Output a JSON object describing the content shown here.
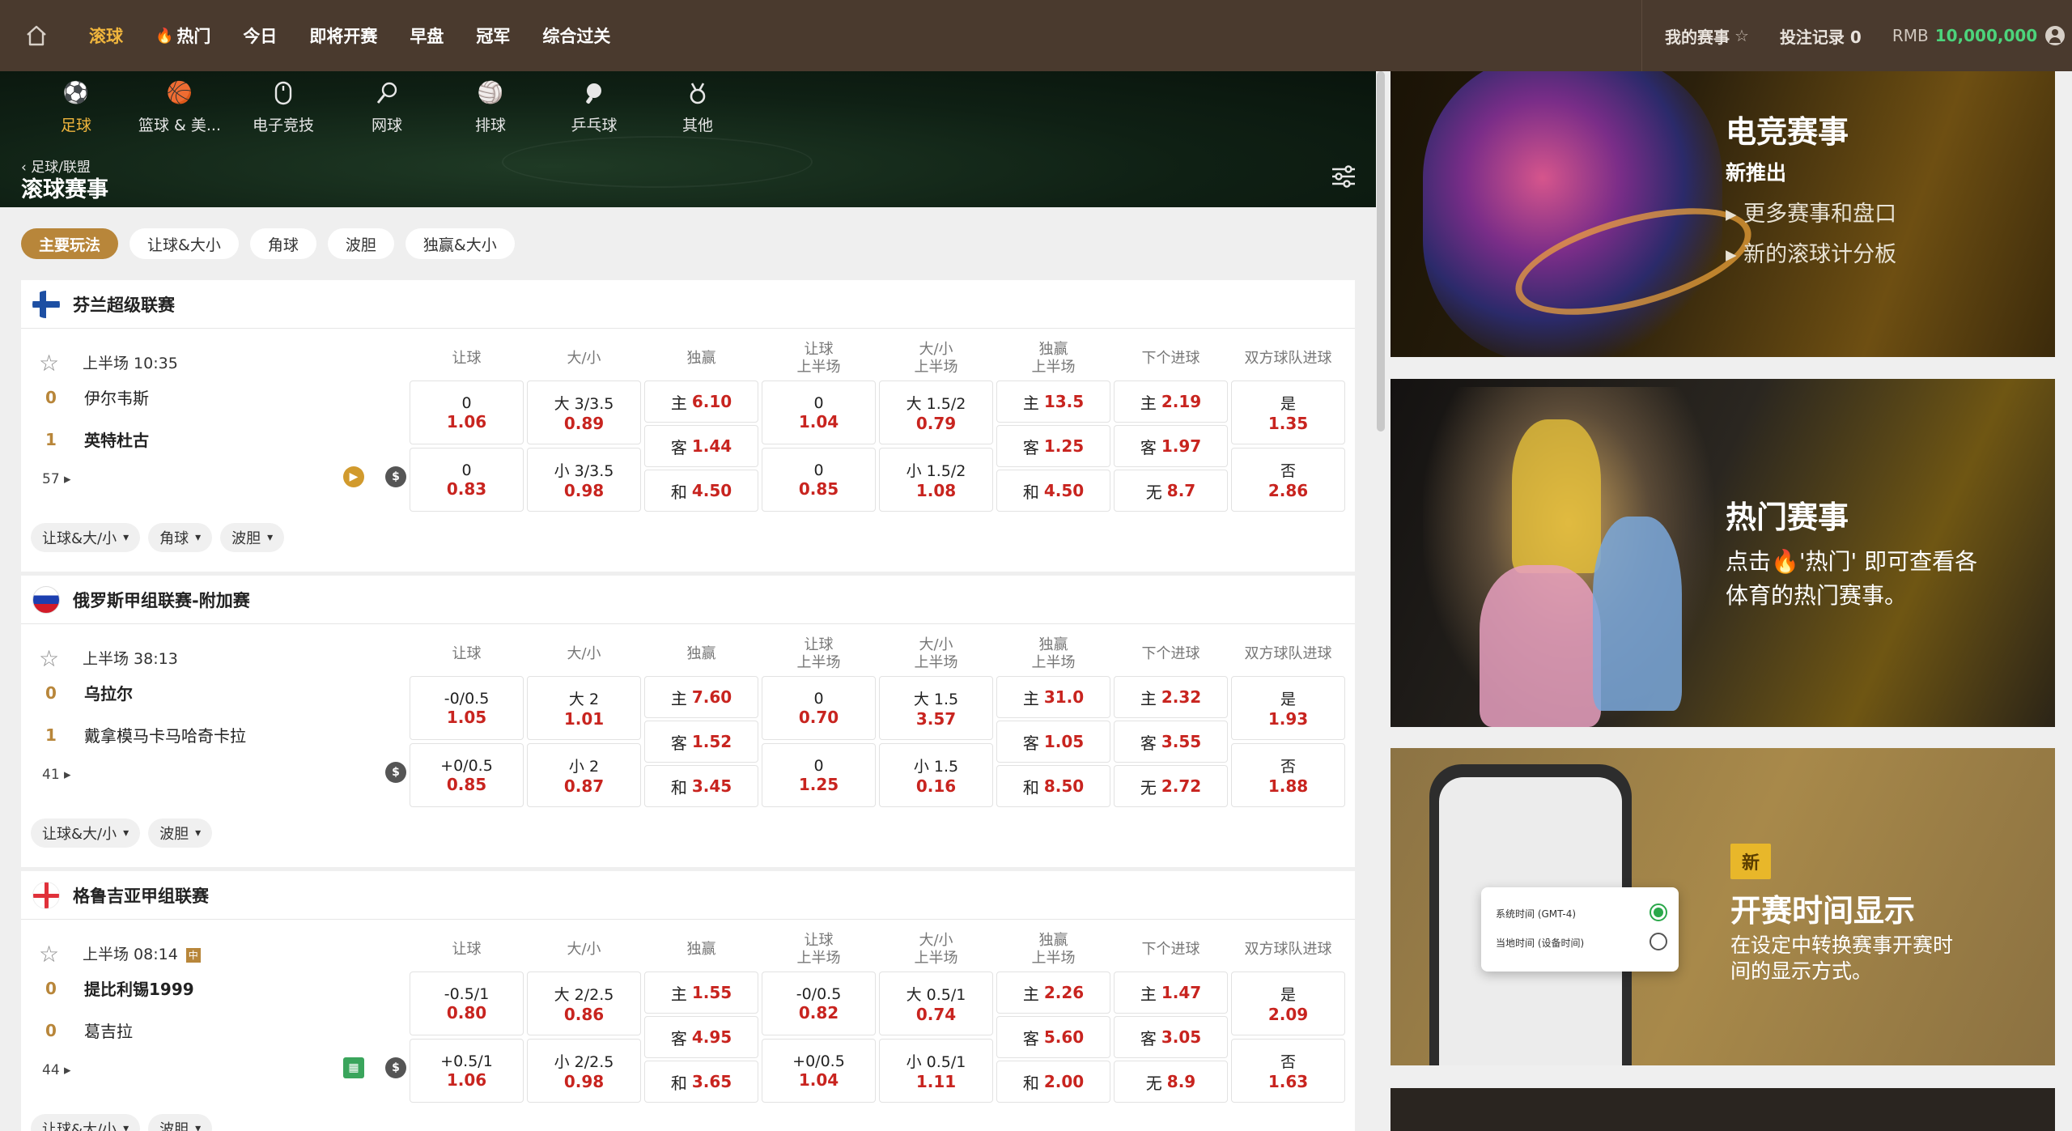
{
  "topnav": {
    "items": [
      {
        "label": "滚球",
        "active": true
      },
      {
        "label": "热门",
        "icon": "fire-icon"
      },
      {
        "label": "今日"
      },
      {
        "label": "即将开赛"
      },
      {
        "label": "早盘"
      },
      {
        "label": "冠军"
      },
      {
        "label": "综合过关"
      }
    ],
    "my_events": "我的赛事",
    "bet_record": "投注记录 0",
    "currency": "RMB",
    "balance": "10,000,000"
  },
  "sports": [
    {
      "label": "足球",
      "icon": "soccer-icon",
      "active": true
    },
    {
      "label": "篮球 & 美...",
      "icon": "basketball-icon"
    },
    {
      "label": "电子竞技",
      "icon": "mouse-icon"
    },
    {
      "label": "网球",
      "icon": "tennis-icon"
    },
    {
      "label": "排球",
      "icon": "volleyball-icon"
    },
    {
      "label": "乒乓球",
      "icon": "table-tennis-icon"
    },
    {
      "label": "其他",
      "icon": "medal-icon"
    }
  ],
  "breadcrumb": "足球/联盟",
  "page_title": "滚球赛事",
  "chips": [
    "主要玩法",
    "让球&大小",
    "角球",
    "波胆",
    "独赢&大小"
  ],
  "column_headers": [
    "让球",
    "大/小",
    "独赢",
    "让球\n上半场",
    "大/小\n上半场",
    "独赢\n上半场",
    "下个进球",
    "双方球队进球"
  ],
  "leagues": [
    {
      "name": "芬兰超级联赛",
      "time": "上半场  10:35",
      "home": {
        "score": "0",
        "name": "伊尔韦斯"
      },
      "away": {
        "score": "1",
        "name": "英特杜古"
      },
      "count": "57",
      "icons": [
        "play-icon",
        "dollar-icon"
      ],
      "odds": [
        [
          {
            "l": "0",
            "o": "1.06"
          },
          {
            "l": "0",
            "o": "0.83"
          }
        ],
        [
          {
            "l": "大 3/3.5",
            "o": "0.89"
          },
          {
            "l": "小 3/3.5",
            "o": "0.98"
          }
        ],
        [
          {
            "l": "主",
            "o": "6.10"
          },
          {
            "l": "客",
            "o": "1.44"
          },
          {
            "l": "和",
            "o": "4.50"
          }
        ],
        [
          {
            "l": "0",
            "o": "1.04"
          },
          {
            "l": "0",
            "o": "0.85"
          }
        ],
        [
          {
            "l": "大 1.5/2",
            "o": "0.79"
          },
          {
            "l": "小 1.5/2",
            "o": "1.08"
          }
        ],
        [
          {
            "l": "主",
            "o": "13.5"
          },
          {
            "l": "客",
            "o": "1.25"
          },
          {
            "l": "和",
            "o": "4.50"
          }
        ],
        [
          {
            "l": "主",
            "o": "2.19"
          },
          {
            "l": "客",
            "o": "1.97"
          },
          {
            "l": "无",
            "o": "8.7"
          }
        ],
        [
          {
            "l": "是",
            "o": "1.35"
          },
          {
            "l": "否",
            "o": "2.86"
          }
        ]
      ],
      "pills": [
        "让球&大/小",
        "角球",
        "波胆"
      ]
    },
    {
      "name": "俄罗斯甲组联赛-附加赛",
      "time": "上半场  38:13",
      "home": {
        "score": "0",
        "name": "乌拉尔"
      },
      "away": {
        "score": "1",
        "name": "戴拿模马卡马哈奇卡拉"
      },
      "count": "41",
      "icons": [
        "dollar-icon"
      ],
      "odds": [
        [
          {
            "l": "-0/0.5",
            "o": "1.05"
          },
          {
            "l": "+0/0.5",
            "o": "0.85"
          }
        ],
        [
          {
            "l": "大 2",
            "o": "1.01"
          },
          {
            "l": "小 2",
            "o": "0.87"
          }
        ],
        [
          {
            "l": "主",
            "o": "7.60"
          },
          {
            "l": "客",
            "o": "1.52"
          },
          {
            "l": "和",
            "o": "3.45"
          }
        ],
        [
          {
            "l": "0",
            "o": "0.70"
          },
          {
            "l": "0",
            "o": "1.25"
          }
        ],
        [
          {
            "l": "大 1.5",
            "o": "3.57"
          },
          {
            "l": "小 1.5",
            "o": "0.16"
          }
        ],
        [
          {
            "l": "主",
            "o": "31.0"
          },
          {
            "l": "客",
            "o": "1.05"
          },
          {
            "l": "和",
            "o": "8.50"
          }
        ],
        [
          {
            "l": "主",
            "o": "2.32"
          },
          {
            "l": "客",
            "o": "3.55"
          },
          {
            "l": "无",
            "o": "2.72"
          }
        ],
        [
          {
            "l": "是",
            "o": "1.93"
          },
          {
            "l": "否",
            "o": "1.88"
          }
        ]
      ],
      "pills": [
        "让球&大/小",
        "波胆"
      ]
    },
    {
      "name": "格鲁吉亚甲组联赛",
      "time": "上半场  08:14",
      "home": {
        "score": "0",
        "name": "提比利锡1999"
      },
      "away": {
        "score": "0",
        "name": "葛吉拉"
      },
      "count": "44",
      "icons": [
        "pitch-icon",
        "dollar-icon"
      ],
      "odds": [
        [
          {
            "l": "-0.5/1",
            "o": "0.80"
          },
          {
            "l": "+0.5/1",
            "o": "1.06"
          }
        ],
        [
          {
            "l": "大 2/2.5",
            "o": "0.86"
          },
          {
            "l": "小 2/2.5",
            "o": "0.98"
          }
        ],
        [
          {
            "l": "主",
            "o": "1.55"
          },
          {
            "l": "客",
            "o": "4.95"
          },
          {
            "l": "和",
            "o": "3.65"
          }
        ],
        [
          {
            "l": "-0/0.5",
            "o": "0.82"
          },
          {
            "l": "+0/0.5",
            "o": "1.04"
          }
        ],
        [
          {
            "l": "大 0.5/1",
            "o": "0.74"
          },
          {
            "l": "小 0.5/1",
            "o": "1.11"
          }
        ],
        [
          {
            "l": "主",
            "o": "2.26"
          },
          {
            "l": "客",
            "o": "5.60"
          },
          {
            "l": "和",
            "o": "2.00"
          }
        ],
        [
          {
            "l": "主",
            "o": "1.47"
          },
          {
            "l": "客",
            "o": "3.05"
          },
          {
            "l": "无",
            "o": "8.9"
          }
        ],
        [
          {
            "l": "是",
            "o": "2.09"
          },
          {
            "l": "否",
            "o": "1.63"
          }
        ]
      ],
      "pills": [
        "让球&大/小",
        "波胆"
      ]
    }
  ],
  "banners": {
    "esports": {
      "title": "电竞赛事",
      "subtitle": "新推出",
      "points": [
        "▸ 更多赛事和盘口",
        "▸ 新的滚球计分板"
      ]
    },
    "hot": {
      "title": "热门赛事",
      "text_1": "点击🔥'热门' 即可查看各",
      "text_2": "体育的热门赛事。"
    },
    "time": {
      "badge": "新",
      "title": "开赛时间显示",
      "text_1": "在设定中转换赛事开赛时",
      "text_2": "间的显示方式。",
      "opt_system": "系统时间 (GMT-4)",
      "opt_local": "当地时间 (设备时间)"
    }
  },
  "colors": {
    "accent": "#b8863a",
    "odds_red": "#c8241f",
    "topbar": "#4a3a2e",
    "balance_green": "#4cd37b"
  }
}
